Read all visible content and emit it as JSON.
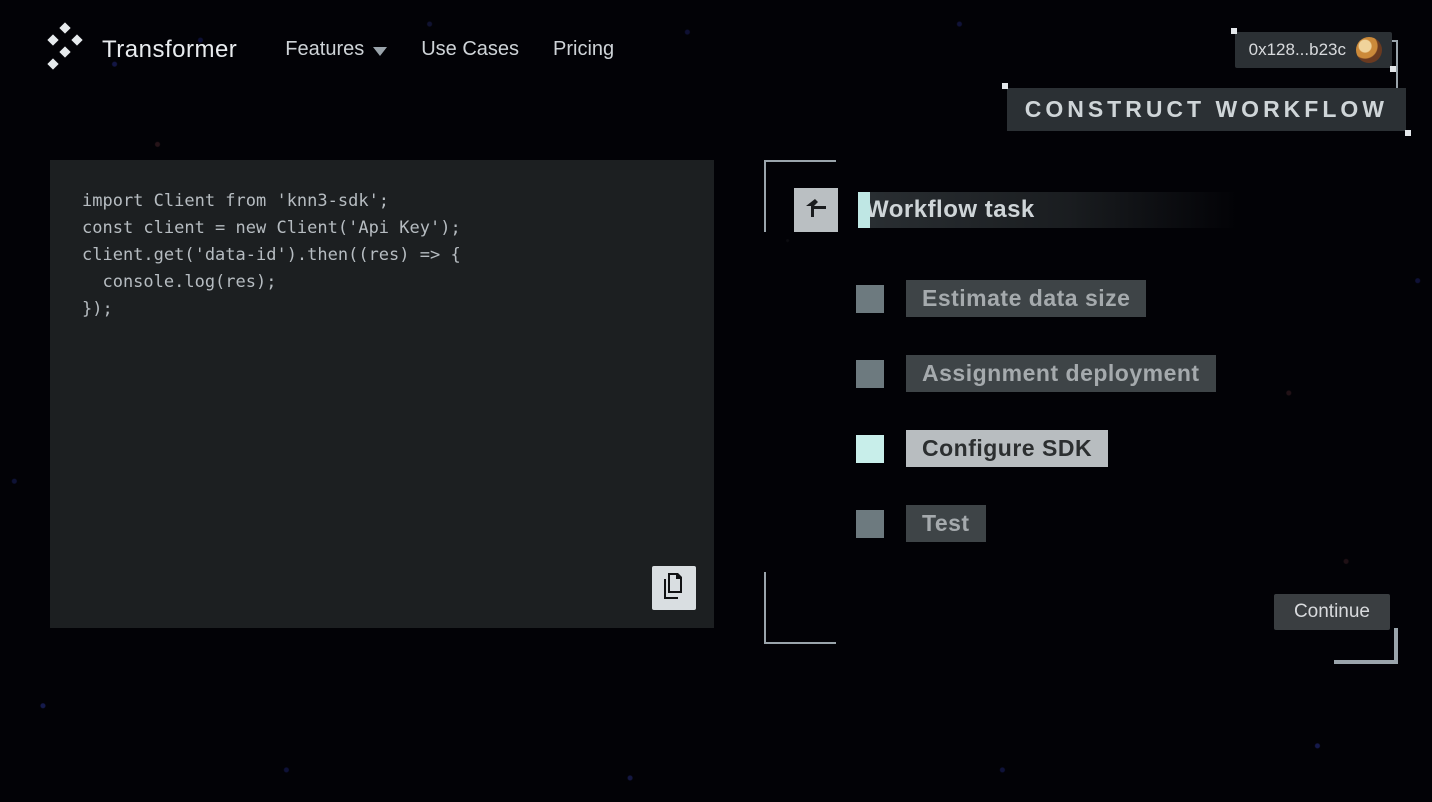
{
  "brand": {
    "name": "Transformer"
  },
  "nav": {
    "features": "Features",
    "use_cases": "Use Cases",
    "pricing": "Pricing"
  },
  "wallet": {
    "address_short": "0x128...b23c"
  },
  "banner": {
    "construct_workflow": "CONSTRUCT WORKFLOW"
  },
  "code": {
    "lines": [
      "import Client from 'knn3-sdk';",
      "const client = new Client('Api Key');",
      "client.get('data-id').then((res) => {",
      "  console.log(res);",
      "});"
    ]
  },
  "workflow": {
    "title": "Workflow task",
    "tasks": [
      {
        "label": "Estimate data size",
        "active": false
      },
      {
        "label": "Assignment deployment",
        "active": false
      },
      {
        "label": "Configure SDK",
        "active": true
      },
      {
        "label": "Test",
        "active": false
      }
    ],
    "continue_label": "Continue"
  },
  "icons": {
    "logo": "logo-icon",
    "chevron_down": "chevron-down-icon",
    "avatar": "avatar-icon",
    "back": "back-arrow-icon",
    "copy": "copy-icon"
  }
}
